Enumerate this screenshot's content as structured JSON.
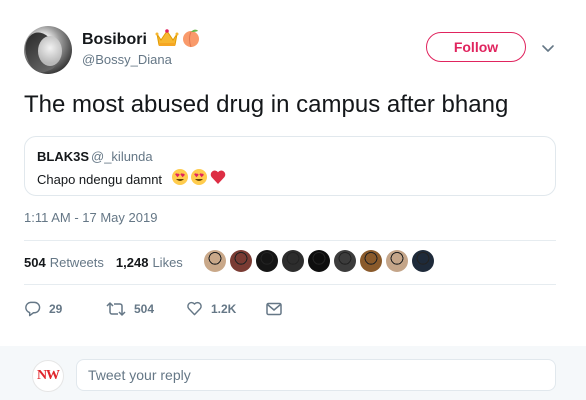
{
  "author": {
    "display_name": "Bosibori",
    "display_emojis": [
      "crown",
      "peach"
    ],
    "handle": "@Bossy_Diana"
  },
  "follow_button": {
    "label": "Follow",
    "color": "#e0245e"
  },
  "tweet": {
    "text": "The most abused drug in campus after bhang",
    "timestamp": "1:11 AM - 17 May 2019"
  },
  "quoted_tweet": {
    "name": "BLAK3S",
    "handle": "@_kilunda",
    "text": "Chapo ndengu damnt",
    "emojis": [
      "heart-eyes",
      "heart-eyes",
      "red-heart"
    ]
  },
  "stats": {
    "retweets_count": "504",
    "retweets_label": "Retweets",
    "likes_count": "1,248",
    "likes_label": "Likes"
  },
  "likers": [
    {
      "name": "liker-avatar-1",
      "color": "#c9a889"
    },
    {
      "name": "liker-avatar-2",
      "color": "#7a3b33"
    },
    {
      "name": "liker-avatar-3",
      "color": "#151515"
    },
    {
      "name": "liker-avatar-4",
      "color": "#2d2d2d"
    },
    {
      "name": "liker-avatar-5",
      "color": "#0e0e0e"
    },
    {
      "name": "liker-avatar-6",
      "color": "#3c3c3c"
    },
    {
      "name": "liker-avatar-7",
      "color": "#8a5a2b"
    },
    {
      "name": "liker-avatar-8",
      "color": "#c4a589"
    },
    {
      "name": "liker-avatar-9",
      "color": "#1e2a3a"
    }
  ],
  "actions": {
    "reply_count": "29",
    "retweet_count": "504",
    "like_count": "1.2K"
  },
  "reply": {
    "avatar_text": "NW",
    "placeholder": "Tweet your reply"
  },
  "colors": {
    "accent": "#e0245e",
    "muted": "#657786",
    "divider": "#e6ecf0",
    "reply_bar": "#f5f8fa"
  }
}
